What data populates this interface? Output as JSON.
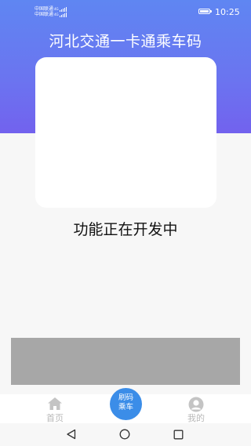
{
  "status_bar": {
    "carrier_1": "中国联通",
    "carrier_2": "中国联通",
    "network_1": "4G",
    "network_2": "4G",
    "time": "10:25"
  },
  "header": {
    "title": "河北交通一卡通乘车码"
  },
  "main": {
    "message": "功能正在开发中"
  },
  "tab_bar": {
    "home_label": "首页",
    "scan_line1": "刷码",
    "scan_line2": "乘车",
    "profile_label": "我的"
  },
  "colors": {
    "header_gradient_top": "#5f86f2",
    "header_gradient_bottom": "#7262ee",
    "fab": "#3b8de8",
    "banner": "#a7a7a7"
  }
}
